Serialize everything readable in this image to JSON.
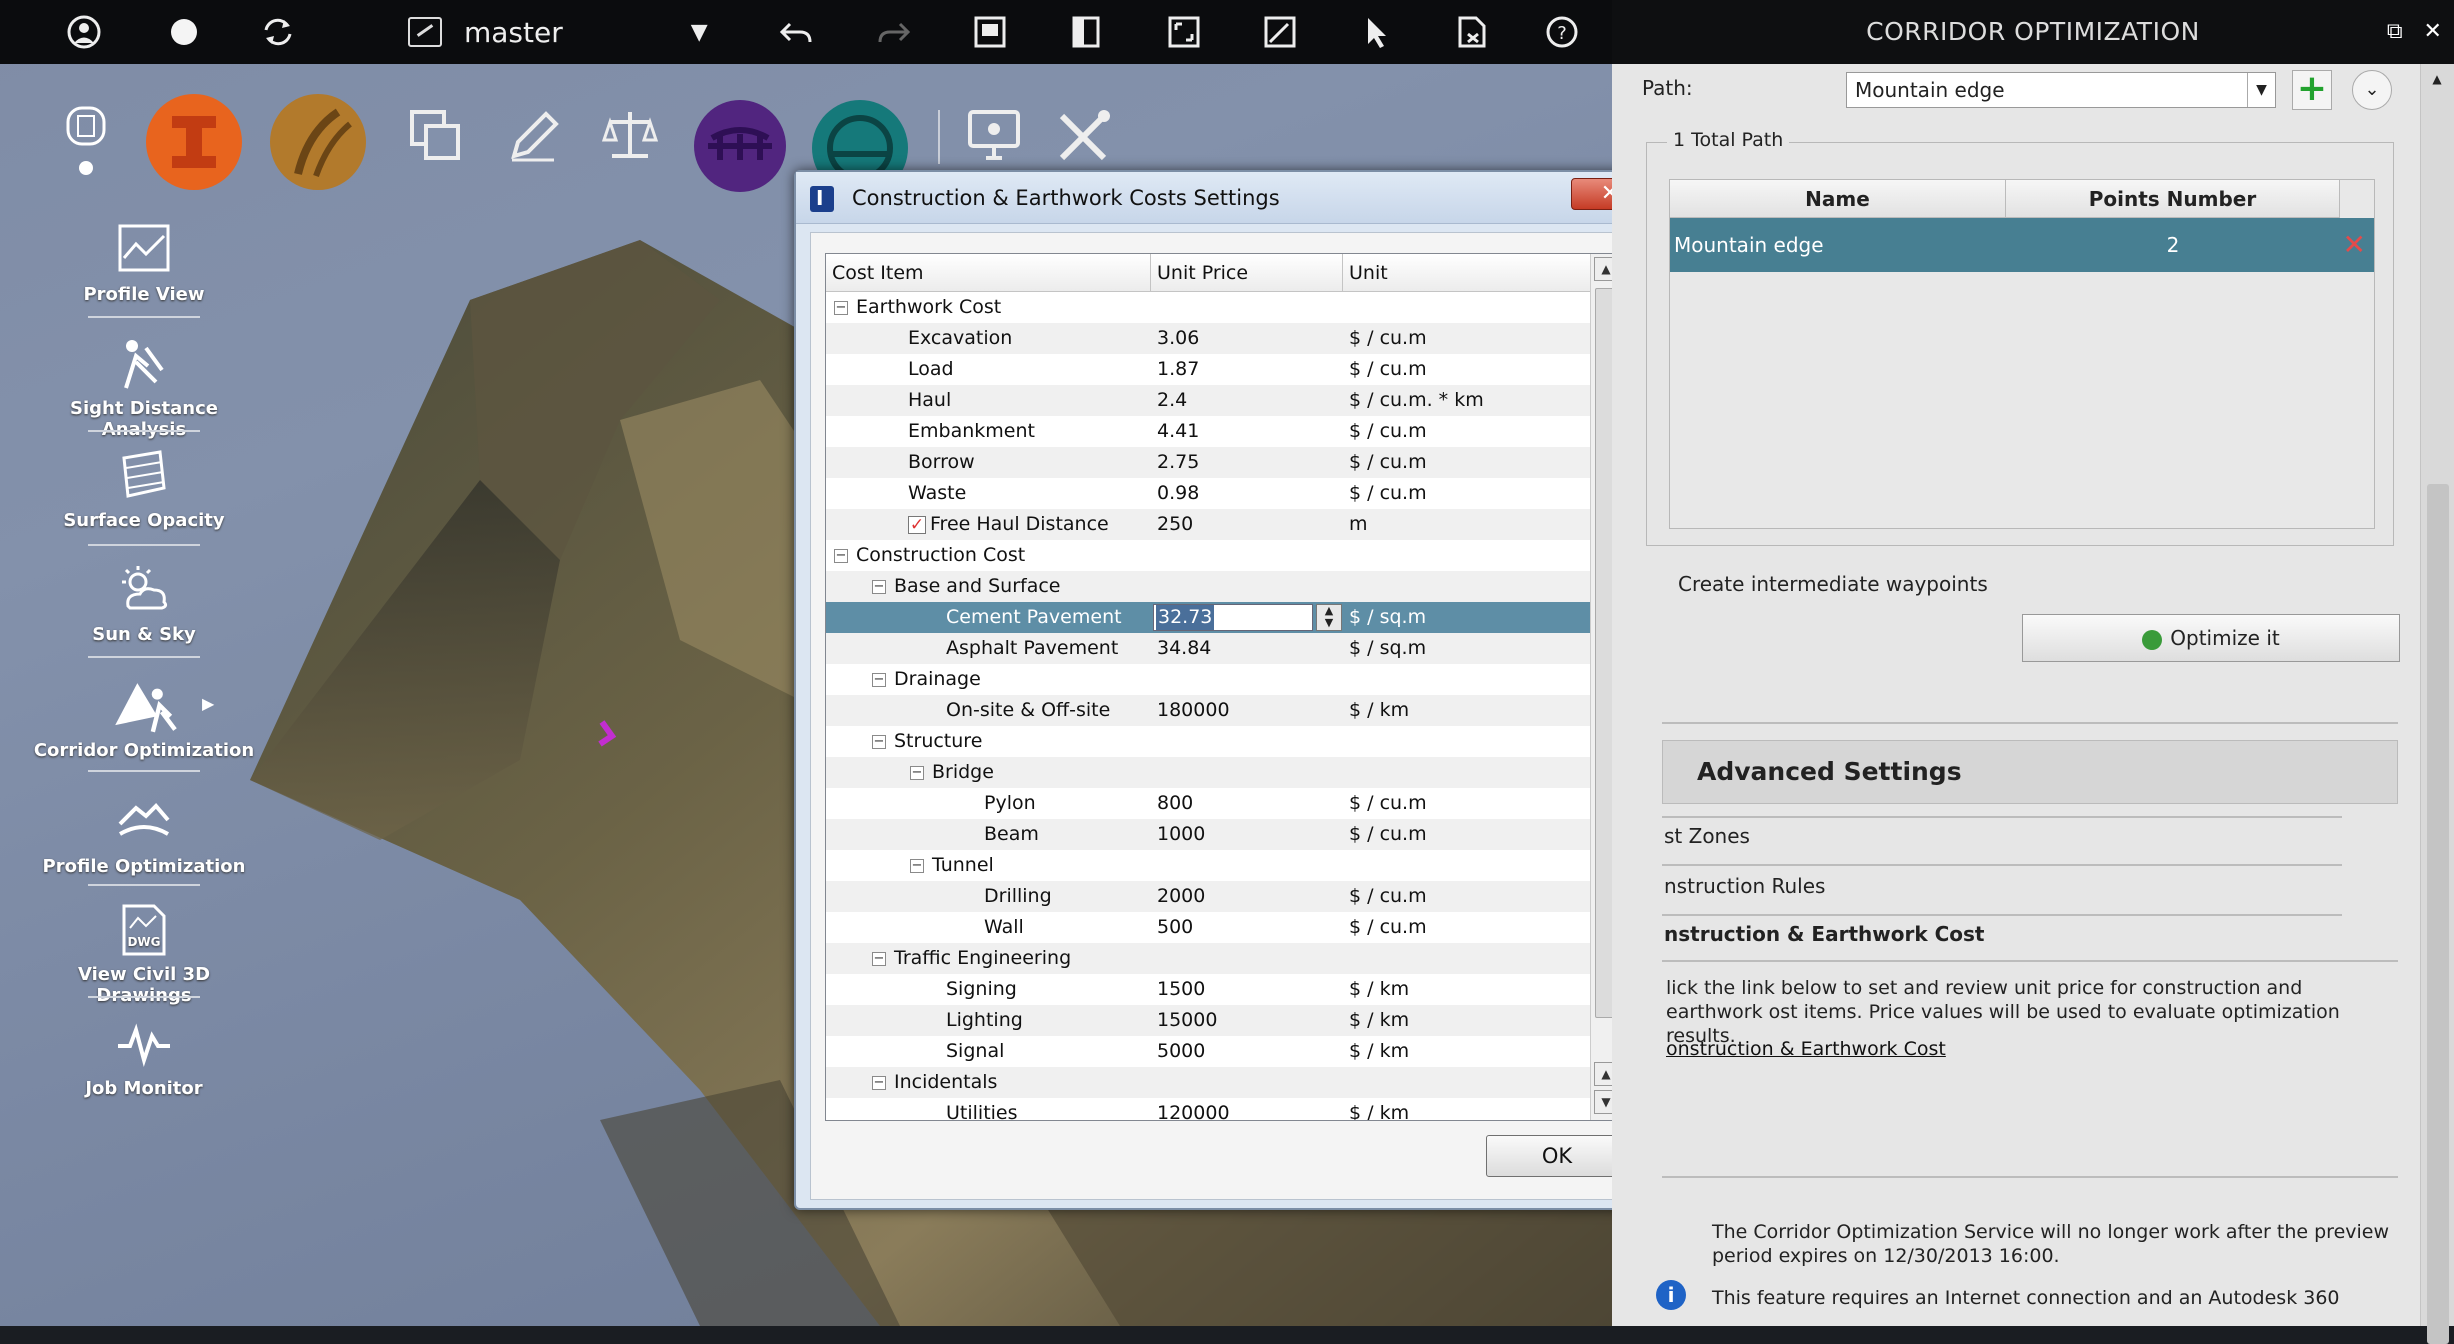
{
  "toolbar": {
    "branch": "master",
    "colors": {
      "orange": "#e8641e",
      "tan": "#b27a2c",
      "purple": "#51257f",
      "teal": "#15797a"
    }
  },
  "nav": [
    {
      "label": "Profile View",
      "icon": "profile-view-icon"
    },
    {
      "label": "Sight Distance Analysis",
      "icon": "sight-distance-icon"
    },
    {
      "label": "Surface Opacity",
      "icon": "surface-opacity-icon"
    },
    {
      "label": "Sun & Sky",
      "icon": "sun-sky-icon"
    },
    {
      "label": "Corridor Optimization",
      "icon": "corridor-optimization-icon"
    },
    {
      "label": "Profile Optimization",
      "icon": "profile-optimization-icon"
    },
    {
      "label": "View Civil 3D Drawings",
      "icon": "dwg-icon"
    },
    {
      "label": "Job Monitor",
      "icon": "job-monitor-icon"
    }
  ],
  "dialog": {
    "title": "Construction & Earthwork Costs Settings",
    "close": "✕",
    "columns": [
      "Cost Item",
      "Unit Price",
      "Unit"
    ],
    "rows": [
      {
        "item": "Earthwork Cost",
        "price": "",
        "unit": "",
        "level": 0,
        "expander": "⊟"
      },
      {
        "item": "Excavation",
        "price": "3.06",
        "unit": "$ / cu.m",
        "level": 1
      },
      {
        "item": "Load",
        "price": "1.87",
        "unit": "$ / cu.m",
        "level": 1
      },
      {
        "item": "Haul",
        "price": "2.4",
        "unit": "$ / cu.m. * km",
        "level": 1
      },
      {
        "item": "Embankment",
        "price": "4.41",
        "unit": "$ / cu.m",
        "level": 1
      },
      {
        "item": "Borrow",
        "price": "2.75",
        "unit": "$ / cu.m",
        "level": 1
      },
      {
        "item": "Waste",
        "price": "0.98",
        "unit": "$ / cu.m",
        "level": 1
      },
      {
        "item": "Free Haul Distance",
        "price": "250",
        "unit": "m",
        "level": 1,
        "checkbox": "✓"
      },
      {
        "item": "Construction Cost",
        "price": "",
        "unit": "",
        "level": 0,
        "expander": "⊟"
      },
      {
        "item": "Base and Surface",
        "price": "",
        "unit": "",
        "level": 1,
        "expander": "⊟"
      },
      {
        "item": "Cement Pavement",
        "price": "32.73",
        "unit": "$ / sq.m",
        "level": 2,
        "selected": true
      },
      {
        "item": "Asphalt Pavement",
        "price": "34.84",
        "unit": "$ / sq.m",
        "level": 2
      },
      {
        "item": "Drainage",
        "price": "",
        "unit": "",
        "level": 1,
        "expander": "⊟"
      },
      {
        "item": "On-site & Off-site",
        "price": "180000",
        "unit": "$ / km",
        "level": 2
      },
      {
        "item": "Structure",
        "price": "",
        "unit": "",
        "level": 1,
        "expander": "⊟"
      },
      {
        "item": "Bridge",
        "price": "",
        "unit": "",
        "level": 2,
        "expander": "⊟"
      },
      {
        "item": "Pylon",
        "price": "800",
        "unit": "$ / cu.m",
        "level": 3
      },
      {
        "item": "Beam",
        "price": "1000",
        "unit": "$ / cu.m",
        "level": 3
      },
      {
        "item": "Tunnel",
        "price": "",
        "unit": "",
        "level": 2,
        "expander": "⊟"
      },
      {
        "item": "Drilling",
        "price": "2000",
        "unit": "$ / cu.m",
        "level": 3
      },
      {
        "item": "Wall",
        "price": "500",
        "unit": "$ / cu.m",
        "level": 3
      },
      {
        "item": "Traffic Engineering",
        "price": "",
        "unit": "",
        "level": 1,
        "expander": "⊟"
      },
      {
        "item": "Signing",
        "price": "1500",
        "unit": "$ / km",
        "level": 2
      },
      {
        "item": "Lighting",
        "price": "15000",
        "unit": "$ / km",
        "level": 2
      },
      {
        "item": "Signal",
        "price": "5000",
        "unit": "$ / km",
        "level": 2
      },
      {
        "item": "Incidentals",
        "price": "",
        "unit": "",
        "level": 1,
        "expander": "⊟"
      },
      {
        "item": "Utilities",
        "price": "120000",
        "unit": "$ / km",
        "level": 2
      }
    ],
    "ok": "OK"
  },
  "panel": {
    "title": "CORRIDOR OPTIMIZATION",
    "path_label": "Path:",
    "path_value": "Mountain edge",
    "add_icon": "+",
    "more_icon": "⌄",
    "group_label": "1 Total Path",
    "table_headers": [
      "Name",
      "Points Number"
    ],
    "table_row": {
      "name": "Mountain edge",
      "points": "2"
    },
    "delete_icon": "✕",
    "waypoints": "Create intermediate waypoints",
    "optimize": "Optimize it",
    "advanced": "Advanced Settings",
    "adv_items": [
      "st Zones",
      "nstruction Rules",
      "nstruction & Earthwork Cost"
    ],
    "adv_desc": "lick the link below to set and review unit price for construction and earthwork ost items. Price values will be used to evaluate optimization results.",
    "adv_link": "onstruction & Earthwork Cost",
    "notice1": "The Corridor Optimization Service will no longer work after the preview period expires on 12/30/2013 16:00.",
    "notice2": "This feature requires an Internet connection and an Autodesk 360",
    "info_icon": "i"
  }
}
